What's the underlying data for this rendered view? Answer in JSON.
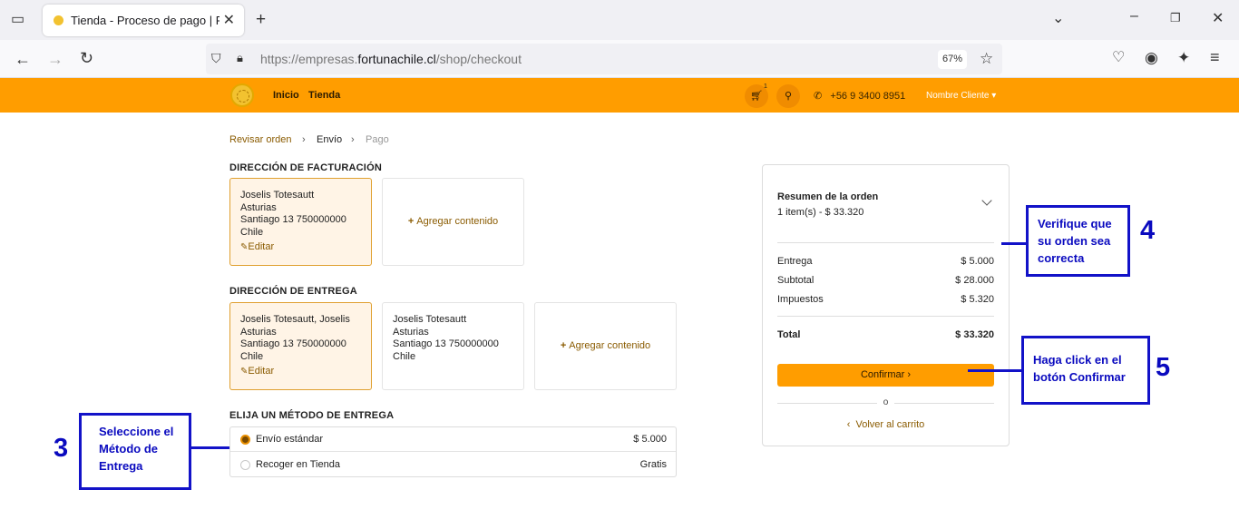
{
  "browser": {
    "tab_title": "Tienda - Proceso de pago | Fortuna",
    "url_prefix": "https://empresas.",
    "url_domain": "fortunachile.cl",
    "url_path": "/shop/checkout",
    "zoom": "67%"
  },
  "site": {
    "menu": [
      "Inicio",
      "Tienda"
    ],
    "cart_count": "1",
    "phone": "+56 9 3400 8951",
    "user": "Nombre Cliente"
  },
  "breadcrumb": [
    "Revisar orden",
    "Envío",
    "Pago"
  ],
  "billing": {
    "title": "DIRECCIÓN DE FACTURACIÓN",
    "card": [
      "Joselis Totesautt",
      "Asturias",
      "Santiago 13 750000000",
      "Chile"
    ],
    "edit": "Editar",
    "add": "Agregar contenido"
  },
  "shipping": {
    "title": "DIRECCIÓN DE ENTREGA",
    "card1": [
      "Joselis Totesautt, Joselis",
      "Asturias",
      "Santiago 13 750000000",
      "Chile"
    ],
    "card2": [
      "Joselis Totesautt",
      "Asturias",
      "Santiago 13 750000000",
      "Chile"
    ],
    "edit": "Editar",
    "add": "Agregar contenido"
  },
  "delivery": {
    "title": "ELIJA UN MÉTODO DE ENTREGA",
    "options": [
      {
        "name": "Envío estándar",
        "price": "$ 5.000"
      },
      {
        "name": "Recoger en Tienda",
        "price": "Gratis"
      }
    ]
  },
  "summary": {
    "title": "Resumen de la orden",
    "items": "1 item(s) -  $ 33.320",
    "rows": [
      {
        "label": "Entrega",
        "value": "$ 5.000"
      },
      {
        "label": "Subtotal",
        "value": "$ 28.000"
      },
      {
        "label": "Impuestos",
        "value": "$ 5.320"
      }
    ],
    "total_label": "Total",
    "total_value": "$ 33.320",
    "confirm": "Confirmar",
    "or": "o",
    "back": "Volver al carrito"
  },
  "callouts": {
    "c3": {
      "num": "3",
      "text": "Seleccione el Método de Entrega"
    },
    "c4": {
      "num": "4",
      "text": "Verifique que su orden sea correcta"
    },
    "c5": {
      "num": "5",
      "text": "Haga click en el botón Confirmar"
    }
  },
  "colors": {
    "accent": "#ff9d00",
    "annotation": "#1212c8"
  }
}
